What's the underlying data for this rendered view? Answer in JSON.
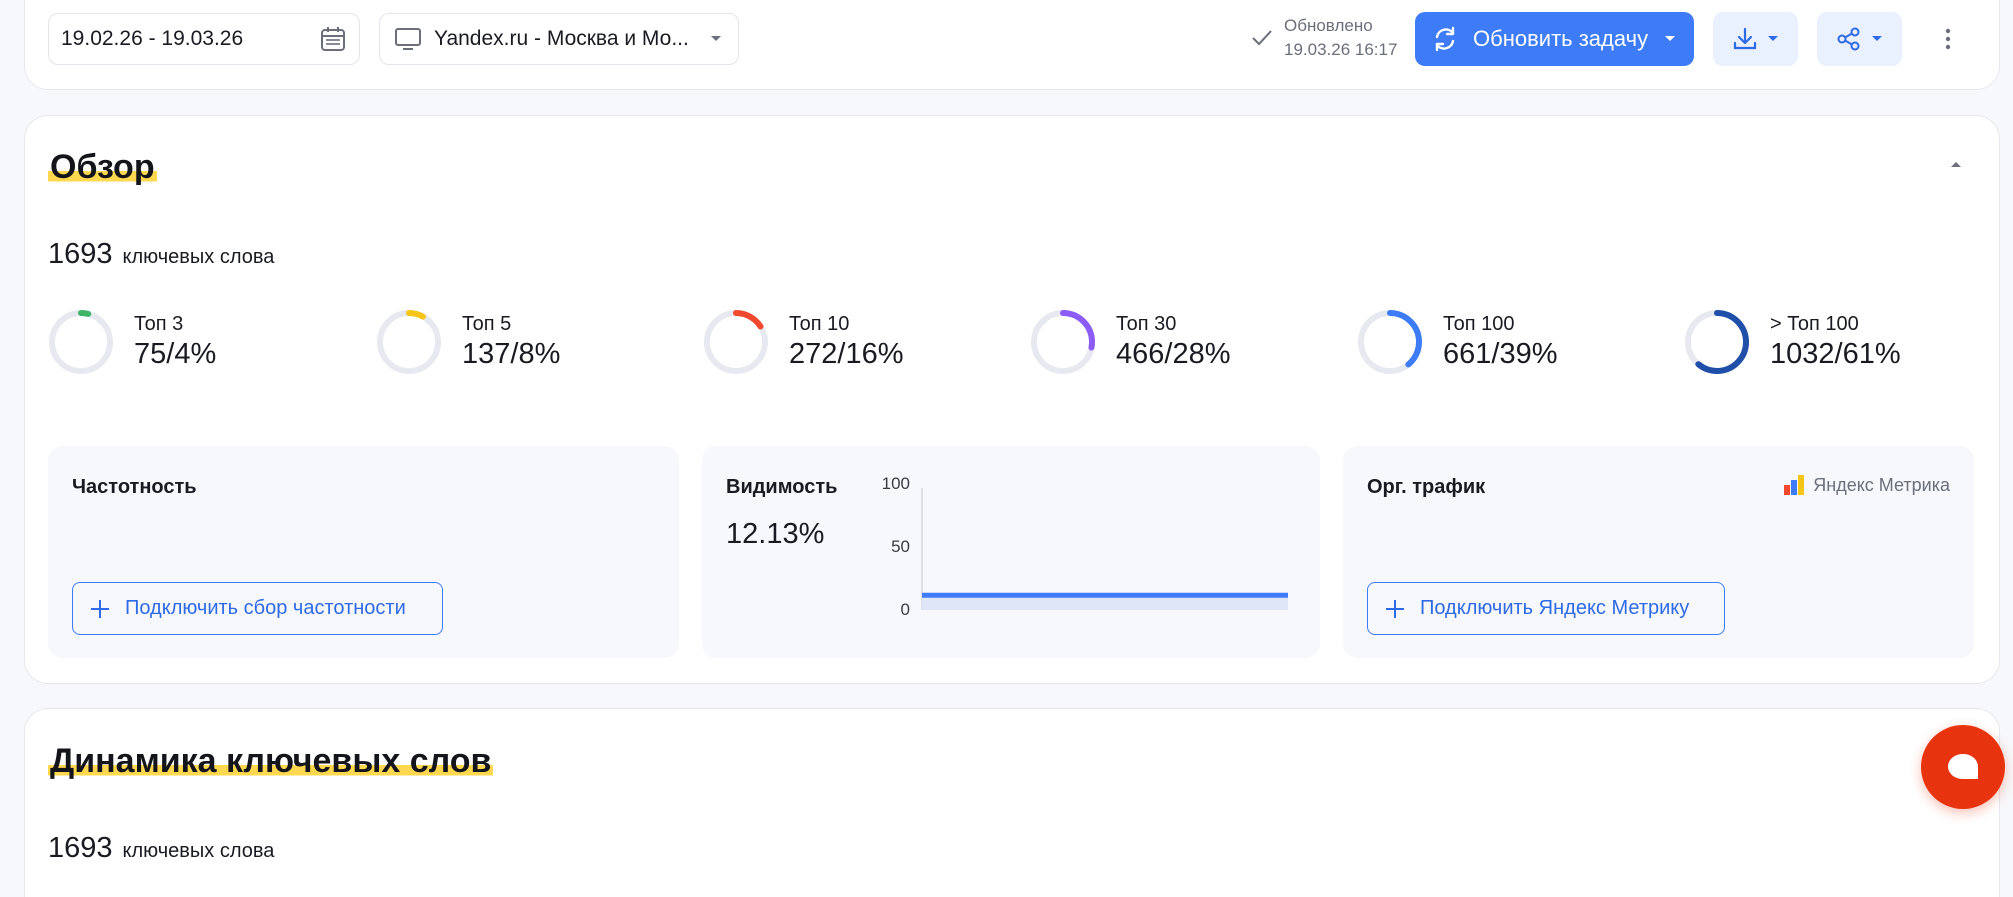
{
  "toolbar": {
    "date_range": "19.02.26 - 19.03.26",
    "region": "Yandex.ru - Москва и Мо...",
    "updated_label": "Обновлено",
    "updated_time": "19.03.26 16:17",
    "update_button": "Обновить задачу"
  },
  "overview": {
    "title": "Обзор",
    "keywords_count": "1693",
    "keywords_label": "ключевых слова",
    "stats": [
      {
        "label": "Топ 3",
        "value": "75/4%",
        "fraction": 0.04,
        "color": "#3fb568"
      },
      {
        "label": "Топ 5",
        "value": "137/8%",
        "fraction": 0.08,
        "color": "#f5c518"
      },
      {
        "label": "Топ 10",
        "value": "272/16%",
        "fraction": 0.16,
        "color": "#f0492e"
      },
      {
        "label": "Топ 30",
        "value": "466/28%",
        "fraction": 0.28,
        "color": "#8b5cf6"
      },
      {
        "label": "Топ 100",
        "value": "661/39%",
        "fraction": 0.39,
        "color": "#3d7bf7"
      },
      {
        "label": "> Топ 100",
        "value": "1032/61%",
        "fraction": 0.61,
        "color": "#1f4fa8"
      }
    ],
    "frequency": {
      "title": "Частотность",
      "button": "Подключить сбор частотности"
    },
    "visibility": {
      "title": "Видимость",
      "value": "12.13%",
      "chart_data": {
        "type": "line",
        "y_ticks": [
          "100",
          "50",
          "0"
        ],
        "ylim": [
          0,
          100
        ],
        "values": [
          12.13,
          12.13
        ]
      }
    },
    "traffic": {
      "title": "Орг. трафик",
      "brand": "Яндекс Метрика",
      "button": "Подключить Яндекс Метрику"
    }
  },
  "dynamics": {
    "title": "Динамика ключевых слов",
    "keywords_count": "1693",
    "keywords_label": "ключевых слова"
  },
  "colors": {
    "accent": "#3d7bf7",
    "highlight": "#ffd84f",
    "chat": "#e8340e"
  }
}
